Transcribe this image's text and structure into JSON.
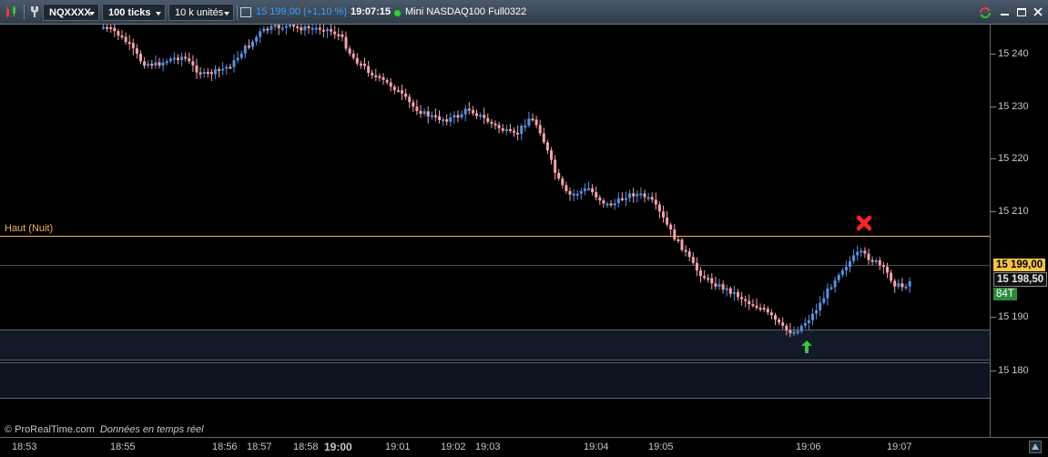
{
  "toolbar": {
    "symbol": "NQXXXX",
    "period": "100 ticks",
    "units": "10 k unités",
    "last_change": "15 199,00 (+1,10 %)",
    "clock": "19:07:15",
    "instrument": "Mini NASDAQ100 Full0322"
  },
  "chart": {
    "level_label": "Haut (Nuit)",
    "footer": "© ProRealTime.com",
    "footer_live": "Données en temps réel",
    "price_tag": "15 199,00",
    "bid_tag": "15 198,50",
    "tick_count": "84T"
  },
  "price_axis": [
    "15 240",
    "15 230",
    "15 220",
    "15 210",
    "15 190",
    "15 180"
  ],
  "time_axis": [
    "18:53",
    "18:55",
    "18:56",
    "18:57",
    "18:58",
    "19:00",
    "19:01",
    "19:02",
    "19:03",
    "19:04",
    "19:05",
    "19:06",
    "19:07"
  ],
  "colors": {
    "up_candle": "#5b8fe0",
    "down_candle": "#f3a3aa",
    "level_line": "#f0b45c",
    "price_tag_bg": "#f6c24a",
    "tick_badge_bg": "#2c8a3a",
    "entry_arrow": "#3cc23c",
    "exit_marker": "#ff2424"
  },
  "icons": {
    "chart-icon": "candles",
    "settings-icon": "wrench",
    "status-dot": "connected",
    "refresh-icon": "swap-arrows",
    "minimize-icon": "minus",
    "maximize-icon": "square",
    "close-icon": "x"
  }
}
